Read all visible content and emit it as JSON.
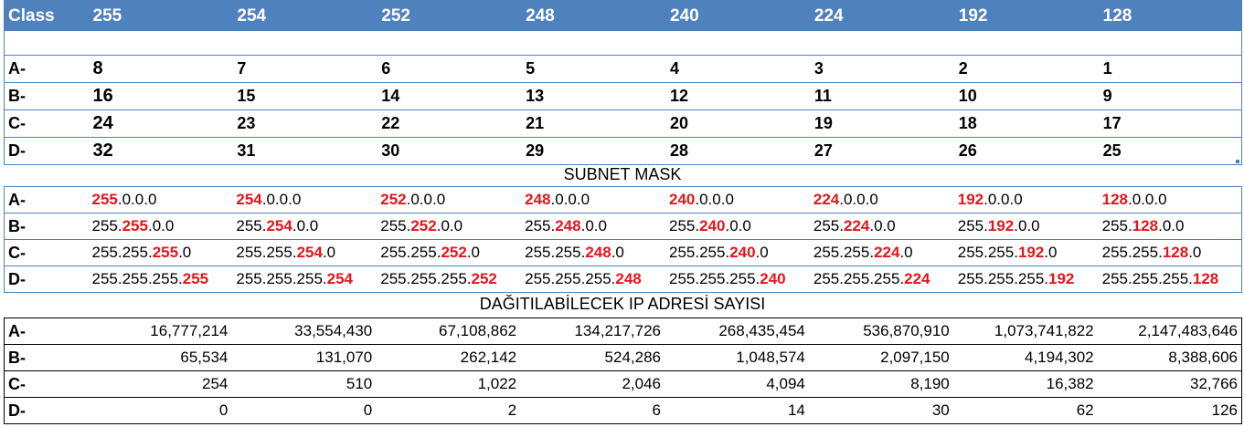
{
  "header": {
    "class_label": "Class",
    "masks": [
      "255",
      "254",
      "252",
      "248",
      "240",
      "224",
      "192",
      "128"
    ]
  },
  "cidr_rows": [
    {
      "label": "A-",
      "values": [
        "8",
        "7",
        "6",
        "5",
        "4",
        "3",
        "2",
        "1"
      ]
    },
    {
      "label": "B-",
      "values": [
        "16",
        "15",
        "14",
        "13",
        "12",
        "11",
        "10",
        "9"
      ]
    },
    {
      "label": "C-",
      "values": [
        "24",
        "23",
        "22",
        "21",
        "20",
        "19",
        "18",
        "17"
      ]
    },
    {
      "label": "D-",
      "values": [
        "32",
        "31",
        "30",
        "29",
        "28",
        "27",
        "26",
        "25"
      ]
    }
  ],
  "subnet_title": "SUBNET MASK",
  "mask_rows": [
    {
      "label": "A-",
      "cells": [
        {
          "pre": "",
          "hl": "255",
          "post": ".0.0.0"
        },
        {
          "pre": "",
          "hl": "254",
          "post": ".0.0.0"
        },
        {
          "pre": "",
          "hl": "252",
          "post": ".0.0.0"
        },
        {
          "pre": "",
          "hl": "248",
          "post": ".0.0.0"
        },
        {
          "pre": "",
          "hl": "240",
          "post": ".0.0.0"
        },
        {
          "pre": "",
          "hl": "224",
          "post": ".0.0.0"
        },
        {
          "pre": "",
          "hl": "192",
          "post": ".0.0.0"
        },
        {
          "pre": "",
          "hl": "128",
          "post": ".0.0.0"
        }
      ]
    },
    {
      "label": "B-",
      "cells": [
        {
          "pre": "255.",
          "hl": "255",
          "post": ".0.0"
        },
        {
          "pre": "255.",
          "hl": "254",
          "post": ".0.0"
        },
        {
          "pre": "255.",
          "hl": "252",
          "post": ".0.0"
        },
        {
          "pre": "255.",
          "hl": "248",
          "post": ".0.0"
        },
        {
          "pre": "255.",
          "hl": "240",
          "post": ".0.0"
        },
        {
          "pre": "255.",
          "hl": "224",
          "post": ".0.0"
        },
        {
          "pre": "255.",
          "hl": "192",
          "post": ".0.0"
        },
        {
          "pre": "255.",
          "hl": "128",
          "post": ".0.0"
        }
      ]
    },
    {
      "label": "C-",
      "cells": [
        {
          "pre": "255.255.",
          "hl": "255",
          "post": ".0"
        },
        {
          "pre": "255.255.",
          "hl": "254",
          "post": ".0"
        },
        {
          "pre": "255.255.",
          "hl": "252",
          "post": ".0"
        },
        {
          "pre": "255.255.",
          "hl": "248",
          "post": ".0"
        },
        {
          "pre": "255.255.",
          "hl": "240",
          "post": ".0"
        },
        {
          "pre": "255.255.",
          "hl": "224",
          "post": ".0"
        },
        {
          "pre": "255.255.",
          "hl": "192",
          "post": ".0"
        },
        {
          "pre": "255.255.",
          "hl": "128",
          "post": ".0"
        }
      ]
    },
    {
      "label": "D-",
      "cells": [
        {
          "pre": "255.255.255.",
          "hl": "255",
          "post": ""
        },
        {
          "pre": "255.255.255.",
          "hl": "254",
          "post": ""
        },
        {
          "pre": "255.255.255.",
          "hl": "252",
          "post": ""
        },
        {
          "pre": "255.255.255.",
          "hl": "248",
          "post": ""
        },
        {
          "pre": "255.255.255.",
          "hl": "240",
          "post": ""
        },
        {
          "pre": "255.255.255.",
          "hl": "224",
          "post": ""
        },
        {
          "pre": "255.255.255.",
          "hl": "192",
          "post": ""
        },
        {
          "pre": "255.255.255.",
          "hl": "128",
          "post": ""
        }
      ]
    }
  ],
  "ip_title": "DAĞITILABİLECEK IP ADRESİ SAYISI",
  "ip_rows": [
    {
      "label": "A-",
      "values": [
        "16,777,214",
        "33,554,430",
        "67,108,862",
        "134,217,726",
        "268,435,454",
        "536,870,910",
        "1,073,741,822",
        "2,147,483,646"
      ]
    },
    {
      "label": "B-",
      "values": [
        "65,534",
        "131,070",
        "262,142",
        "524,286",
        "1,048,574",
        "2,097,150",
        "4,194,302",
        "8,388,606"
      ]
    },
    {
      "label": "C-",
      "values": [
        "254",
        "510",
        "1,022",
        "2,046",
        "4,094",
        "8,190",
        "16,382",
        "32,766"
      ]
    },
    {
      "label": "D-",
      "values": [
        "0",
        "0",
        "2",
        "6",
        "14",
        "30",
        "62",
        "126"
      ]
    }
  ],
  "colors": {
    "header_blue": "#4f81bd",
    "highlight_red": "#e3161c"
  }
}
